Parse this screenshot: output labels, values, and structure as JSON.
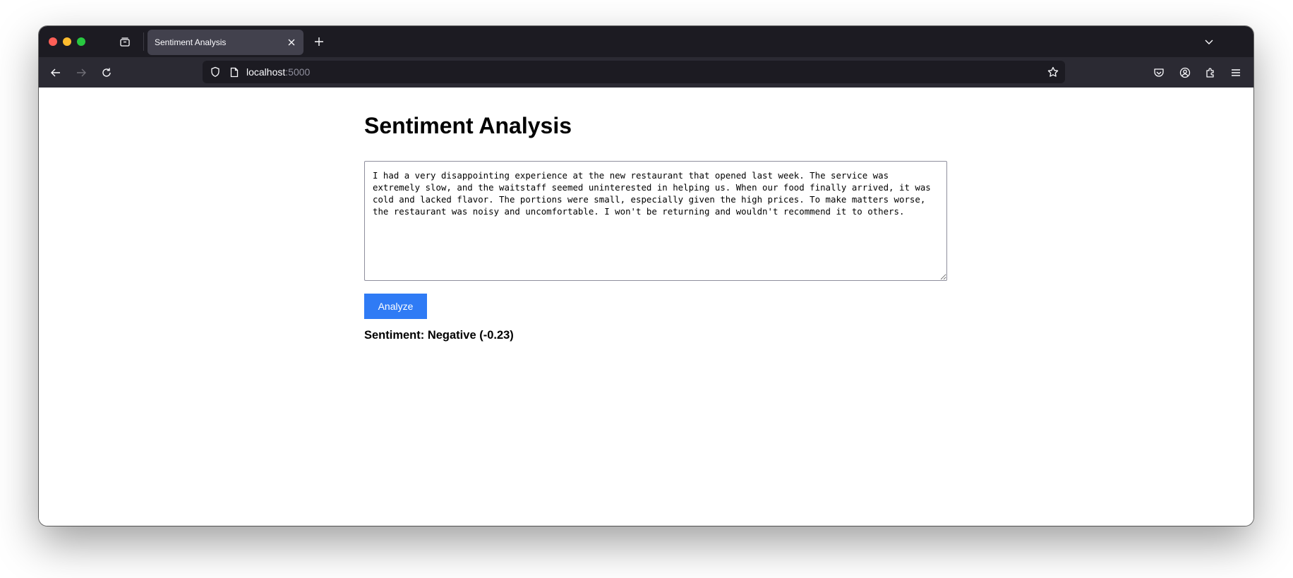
{
  "browser": {
    "tab": {
      "title": "Sentiment Analysis"
    },
    "url": {
      "host": "localhost",
      "port": ":5000"
    }
  },
  "page": {
    "title": "Sentiment Analysis",
    "review_text": "I had a very disappointing experience at the new restaurant that opened last week. The service was extremely slow, and the waitstaff seemed uninterested in helping us. When our food finally arrived, it was cold and lacked flavor. The portions were small, especially given the high prices. To make matters worse, the restaurant was noisy and uncomfortable. I won't be returning and wouldn't recommend it to others.",
    "analyze_label": "Analyze",
    "result_text": "Sentiment: Negative (-0.23)"
  },
  "colors": {
    "accent": "#2f7bf5",
    "tabstrip": "#1c1b22",
    "navbar": "#2b2a33"
  }
}
